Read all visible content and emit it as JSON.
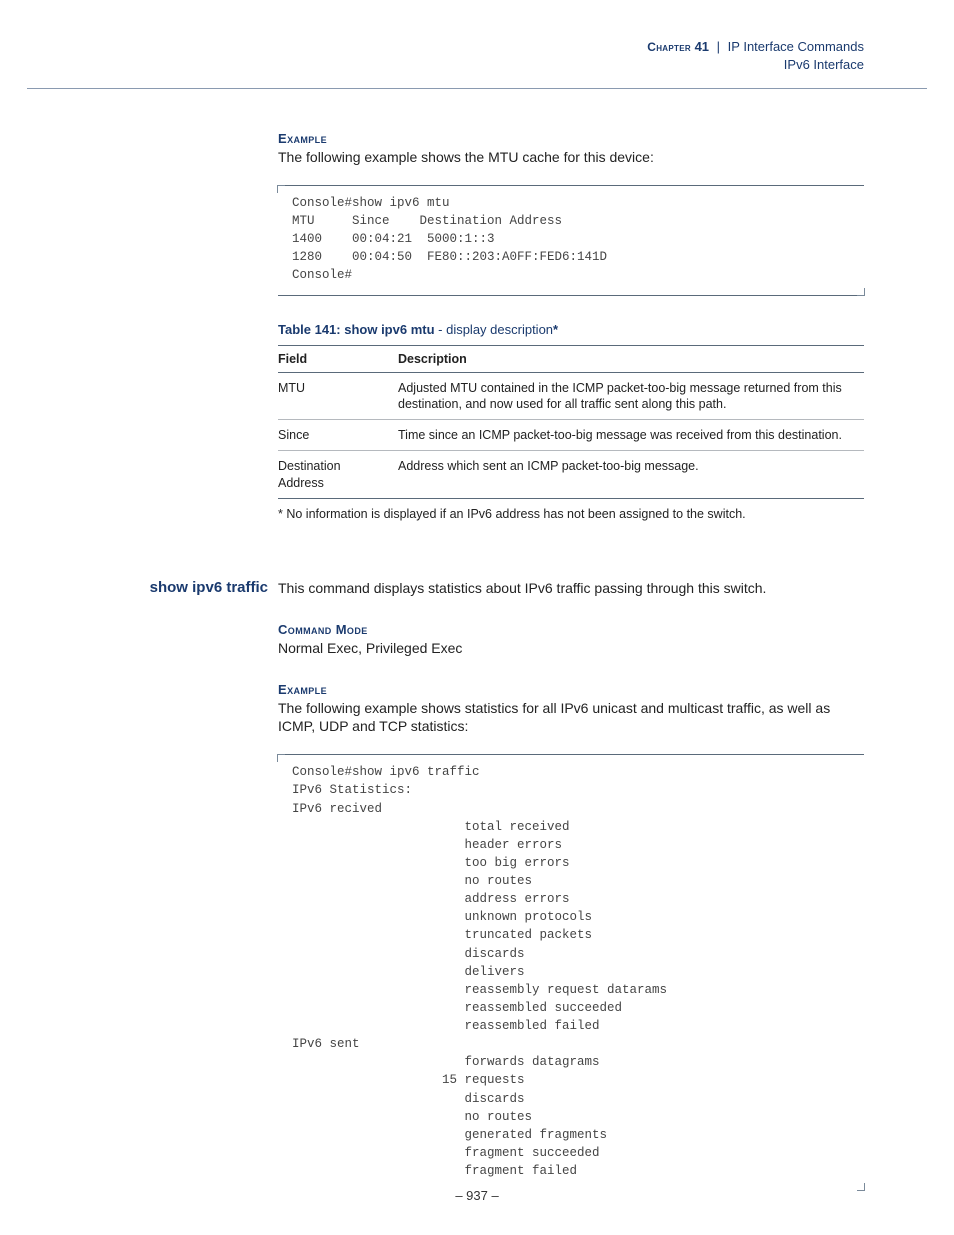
{
  "header": {
    "chapter_label": "Chapter",
    "chapter_number": "41",
    "divider": "|",
    "section_title": "IP Interface Commands",
    "subsection": "IPv6 Interface"
  },
  "example1": {
    "heading": "Example",
    "text": "The following example shows the MTU cache for this device:",
    "code": "Console#show ipv6 mtu\nMTU     Since    Destination Address\n1400    00:04:21  5000:1::3\n1280    00:04:50  FE80::203:A0FF:FED6:141D\nConsole#"
  },
  "table141": {
    "title_bold": "Table 141: show ipv6 mtu",
    "title_rest": " - display description",
    "asterisk": "*",
    "col_field": "Field",
    "col_desc": "Description",
    "rows": [
      {
        "field": "MTU",
        "desc": "Adjusted MTU contained in the ICMP packet-too-big message returned from this destination, and now used for all traffic sent along this path."
      },
      {
        "field": "Since",
        "desc": "Time since an ICMP packet-too-big message was received from this destination."
      },
      {
        "field": "Destination Address",
        "desc": "Address which sent an ICMP packet-too-big message."
      }
    ],
    "footnote": "* No information is displayed if an IPv6 address has not been assigned to the switch."
  },
  "command2": {
    "name": "show ipv6 traffic",
    "desc": "This command displays statistics about IPv6 traffic passing through this switch.",
    "mode_heading": "Command Mode",
    "mode_text": "Normal Exec, Privileged Exec",
    "example_heading": "Example",
    "example_text": "The following example shows statistics for all IPv6 unicast and multicast traffic, as well as ICMP, UDP and TCP statistics:",
    "code": "Console#show ipv6 traffic\nIPv6 Statistics:\nIPv6 recived\n                       total received\n                       header errors\n                       too big errors\n                       no routes\n                       address errors\n                       unknown protocols\n                       truncated packets\n                       discards\n                       delivers\n                       reassembly request datarams\n                       reassembled succeeded\n                       reassembled failed\nIPv6 sent\n                       forwards datagrams\n                    15 requests\n                       discards\n                       no routes\n                       generated fragments\n                       fragment succeeded\n                       fragment failed"
  },
  "page_number": "– 937 –"
}
